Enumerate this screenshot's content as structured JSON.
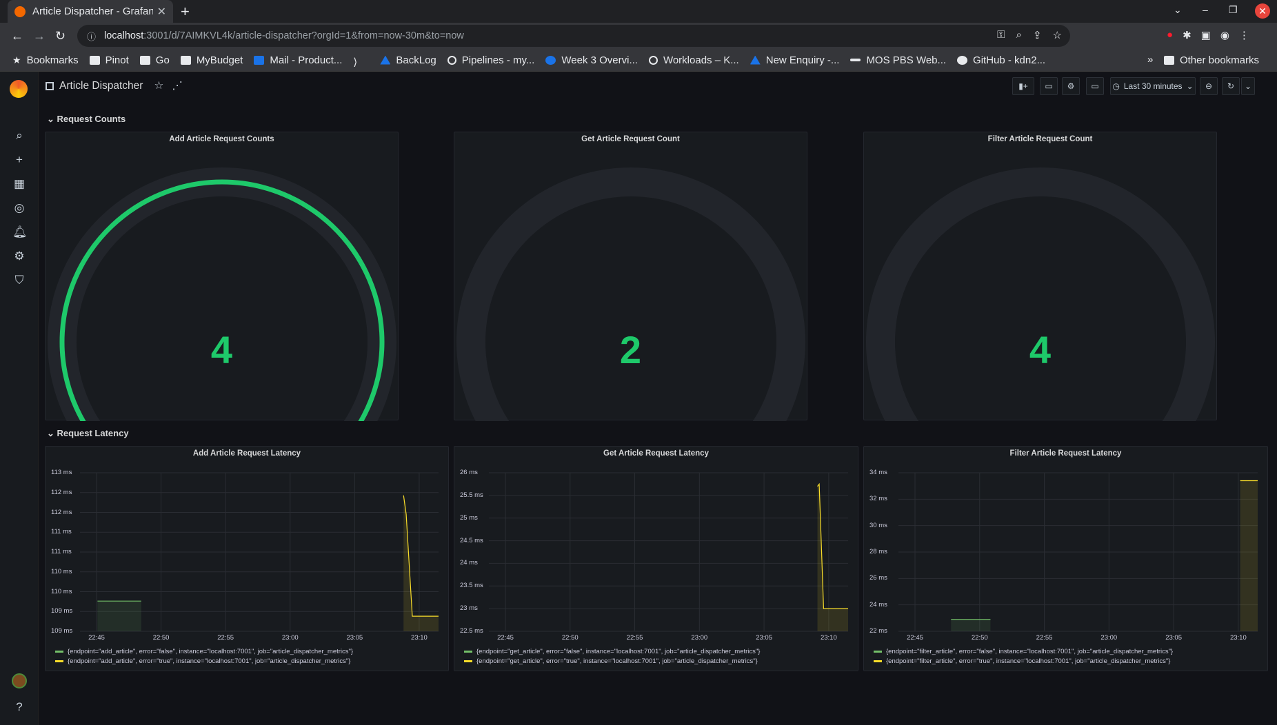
{
  "browser": {
    "tab_title": "Article Dispatcher - Grafana",
    "url_host": "localhost",
    "url_path": ":3001/d/7AIMKVL4k/article-dispatcher?orgId=1&from=now-30m&to=now",
    "bookmarks": [
      "Bookmarks",
      "Pinot",
      "Go",
      "MyBudget",
      "Mail - Product...",
      "BackLog",
      "Pipelines - my...",
      "Week 3 Overvi...",
      "Workloads – K...",
      "New Enquiry -...",
      "MOS PBS Web...",
      "GitHub - kdn2..."
    ],
    "other_bookmarks": "Other bookmarks"
  },
  "dashboard": {
    "title": "Article Dispatcher",
    "time_range": "Last 30 minutes"
  },
  "rows": {
    "counts_title": "Request Counts",
    "latency_title": "Request Latency"
  },
  "gauges": [
    {
      "title": "Add Article Request Counts",
      "value": "4",
      "fill_fraction": 1.0
    },
    {
      "title": "Get Article Request Count",
      "value": "2",
      "fill_fraction": 0.0
    },
    {
      "title": "Filter Article Request Count",
      "value": "4",
      "fill_fraction": 0.0
    }
  ],
  "colors": {
    "gauge_green": "#1ec96a",
    "series_false": "#73bf69",
    "series_true": "#fade2a",
    "background": "#111217",
    "panel": "#181b1f"
  },
  "chart_data": [
    {
      "type": "line",
      "title": "Add Article Request Latency",
      "y_ticks": [
        "113 ms",
        "112 ms",
        "112 ms",
        "111 ms",
        "111 ms",
        "110 ms",
        "110 ms",
        "109 ms",
        "109 ms"
      ],
      "x_ticks": [
        "22:45",
        "22:50",
        "22:55",
        "23:00",
        "23:05",
        "23:10"
      ],
      "ylim": [
        108.8,
        113.0
      ],
      "xlim_min": [
        22.7,
        23.11
      ],
      "series": [
        {
          "name": "{endpoint=\"add_article\", error=\"false\", instance=\"localhost:7001\", job=\"article_dispatcher_metrics\"}",
          "x": [
            22.72,
            22.77
          ],
          "y": [
            109.6,
            109.6
          ]
        },
        {
          "name": "{endpoint=\"add_article\", error=\"true\", instance=\"localhost:7001\", job=\"article_dispatcher_metrics\"}",
          "x": [
            23.07,
            23.073,
            23.08,
            23.11
          ],
          "y": [
            112.4,
            111.9,
            109.2,
            109.2
          ]
        }
      ]
    },
    {
      "type": "line",
      "title": "Get Article Request Latency",
      "y_ticks": [
        "26 ms",
        "25.5 ms",
        "25 ms",
        "24.5 ms",
        "24 ms",
        "23.5 ms",
        "23 ms",
        "22.5 ms"
      ],
      "x_ticks": [
        "22:45",
        "22:50",
        "22:55",
        "23:00",
        "23:05",
        "23:10"
      ],
      "ylim": [
        22.5,
        26.0
      ],
      "xlim_min": [
        22.7,
        23.11
      ],
      "series": [
        {
          "name": "{endpoint=\"get_article\", error=\"false\", instance=\"localhost:7001\", job=\"article_dispatcher_metrics\"}",
          "x": [],
          "y": []
        },
        {
          "name": "{endpoint=\"get_article\", error=\"true\", instance=\"localhost:7001\", job=\"article_dispatcher_metrics\"}",
          "x": [
            23.075,
            23.077,
            23.082,
            23.11
          ],
          "y": [
            25.7,
            25.75,
            23.0,
            23.0
          ]
        }
      ]
    },
    {
      "type": "line",
      "title": "Filter Article Request Latency",
      "y_ticks": [
        "34 ms",
        "32 ms",
        "30 ms",
        "28 ms",
        "26 ms",
        "24 ms",
        "22 ms"
      ],
      "x_ticks": [
        "22:45",
        "22:50",
        "22:55",
        "23:00",
        "23:05",
        "23:10"
      ],
      "ylim": [
        22.0,
        34.0
      ],
      "xlim_min": [
        22.7,
        23.11
      ],
      "series": [
        {
          "name": "{endpoint=\"filter_article\", error=\"false\", instance=\"localhost:7001\", job=\"article_dispatcher_metrics\"}",
          "x": [
            22.76,
            22.805
          ],
          "y": [
            22.9,
            22.9
          ]
        },
        {
          "name": "{endpoint=\"filter_article\", error=\"true\", instance=\"localhost:7001\", job=\"article_dispatcher_metrics\"}",
          "x": [
            23.09,
            23.11
          ],
          "y": [
            33.4,
            33.4
          ]
        }
      ]
    }
  ]
}
